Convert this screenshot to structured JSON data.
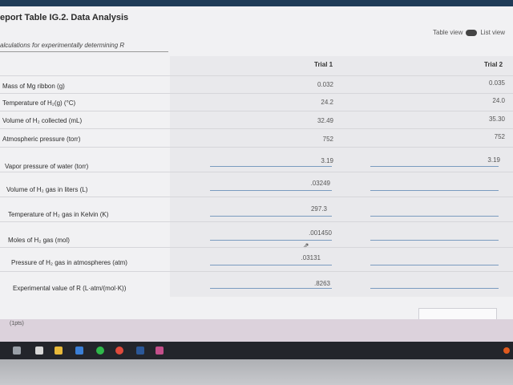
{
  "title": "eport Table IG.2. Data Analysis",
  "toggle": {
    "table_view": "Table view",
    "list_view": "List view"
  },
  "subtitle": "alculations for experimentally determining R",
  "headers": {
    "trial1": "Trial 1",
    "trial2": "Trial 2"
  },
  "rows": [
    {
      "label": "Mass of Mg ribbon (g)",
      "t1": "0.032",
      "t2": "0.035"
    },
    {
      "label": "Temperature of H₂(g) (°C)",
      "t1": "24.2",
      "t2": "24.0"
    },
    {
      "label": "Volume of H₂ collected (mL)",
      "t1": "32.49",
      "t2": "35.30"
    },
    {
      "label": "Atmospheric pressure (torr)",
      "t1": "752",
      "t2": "752"
    },
    {
      "label": "Vapor pressure of water (torr)",
      "t1": "3.19",
      "t2": "3.19"
    },
    {
      "label": "Volume of H₂ gas in liters (L)",
      "t1": ".03249",
      "t2": ""
    },
    {
      "label": "Temperature of H₂ gas in Kelvin (K)",
      "t1": "297.3",
      "t2": ""
    },
    {
      "label": "Moles of H₂ gas (mol)",
      "t1": ".001450",
      "t2": ""
    },
    {
      "label": "Pressure of H₂ gas in atmospheres (atm)",
      "t1": ".03131",
      "t2": ""
    },
    {
      "label": "Experimental value of R (L·atm/(mol·K))",
      "t1": ".8263",
      "t2": ""
    }
  ],
  "points": "(1pts)",
  "colors": {
    "accent": "#7a9bbf",
    "topbar": "#1f3b57",
    "taskbar": "#23252b"
  }
}
